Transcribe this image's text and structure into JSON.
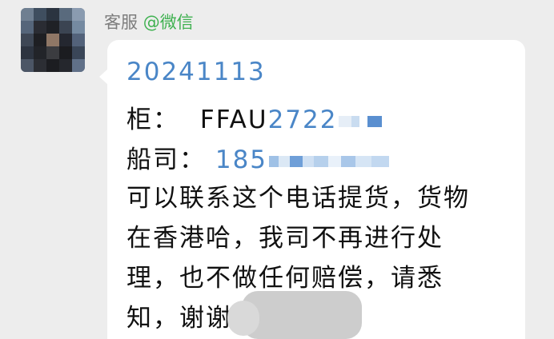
{
  "sender": {
    "name": "客服",
    "channel": "@微信"
  },
  "message": {
    "date": "20241113",
    "container_label": "柜：",
    "container_prefix": "FFAU",
    "container_number_visible": "2722",
    "carrier_label": "船司：",
    "carrier_phone_visible": "185",
    "body_line_1": "可以联系这个电话提货，货物",
    "body_line_2": "在香港哈，我司不再进行处",
    "body_line_3": "理，也不做任何赔偿，请悉",
    "body_line_4": "知，谢谢"
  },
  "colors": {
    "background": "#ededed",
    "bubble": "#ffffff",
    "link_blue": "#4a86c7",
    "wechat_green": "#3fb150",
    "sender_gray": "#7d7d7d"
  }
}
